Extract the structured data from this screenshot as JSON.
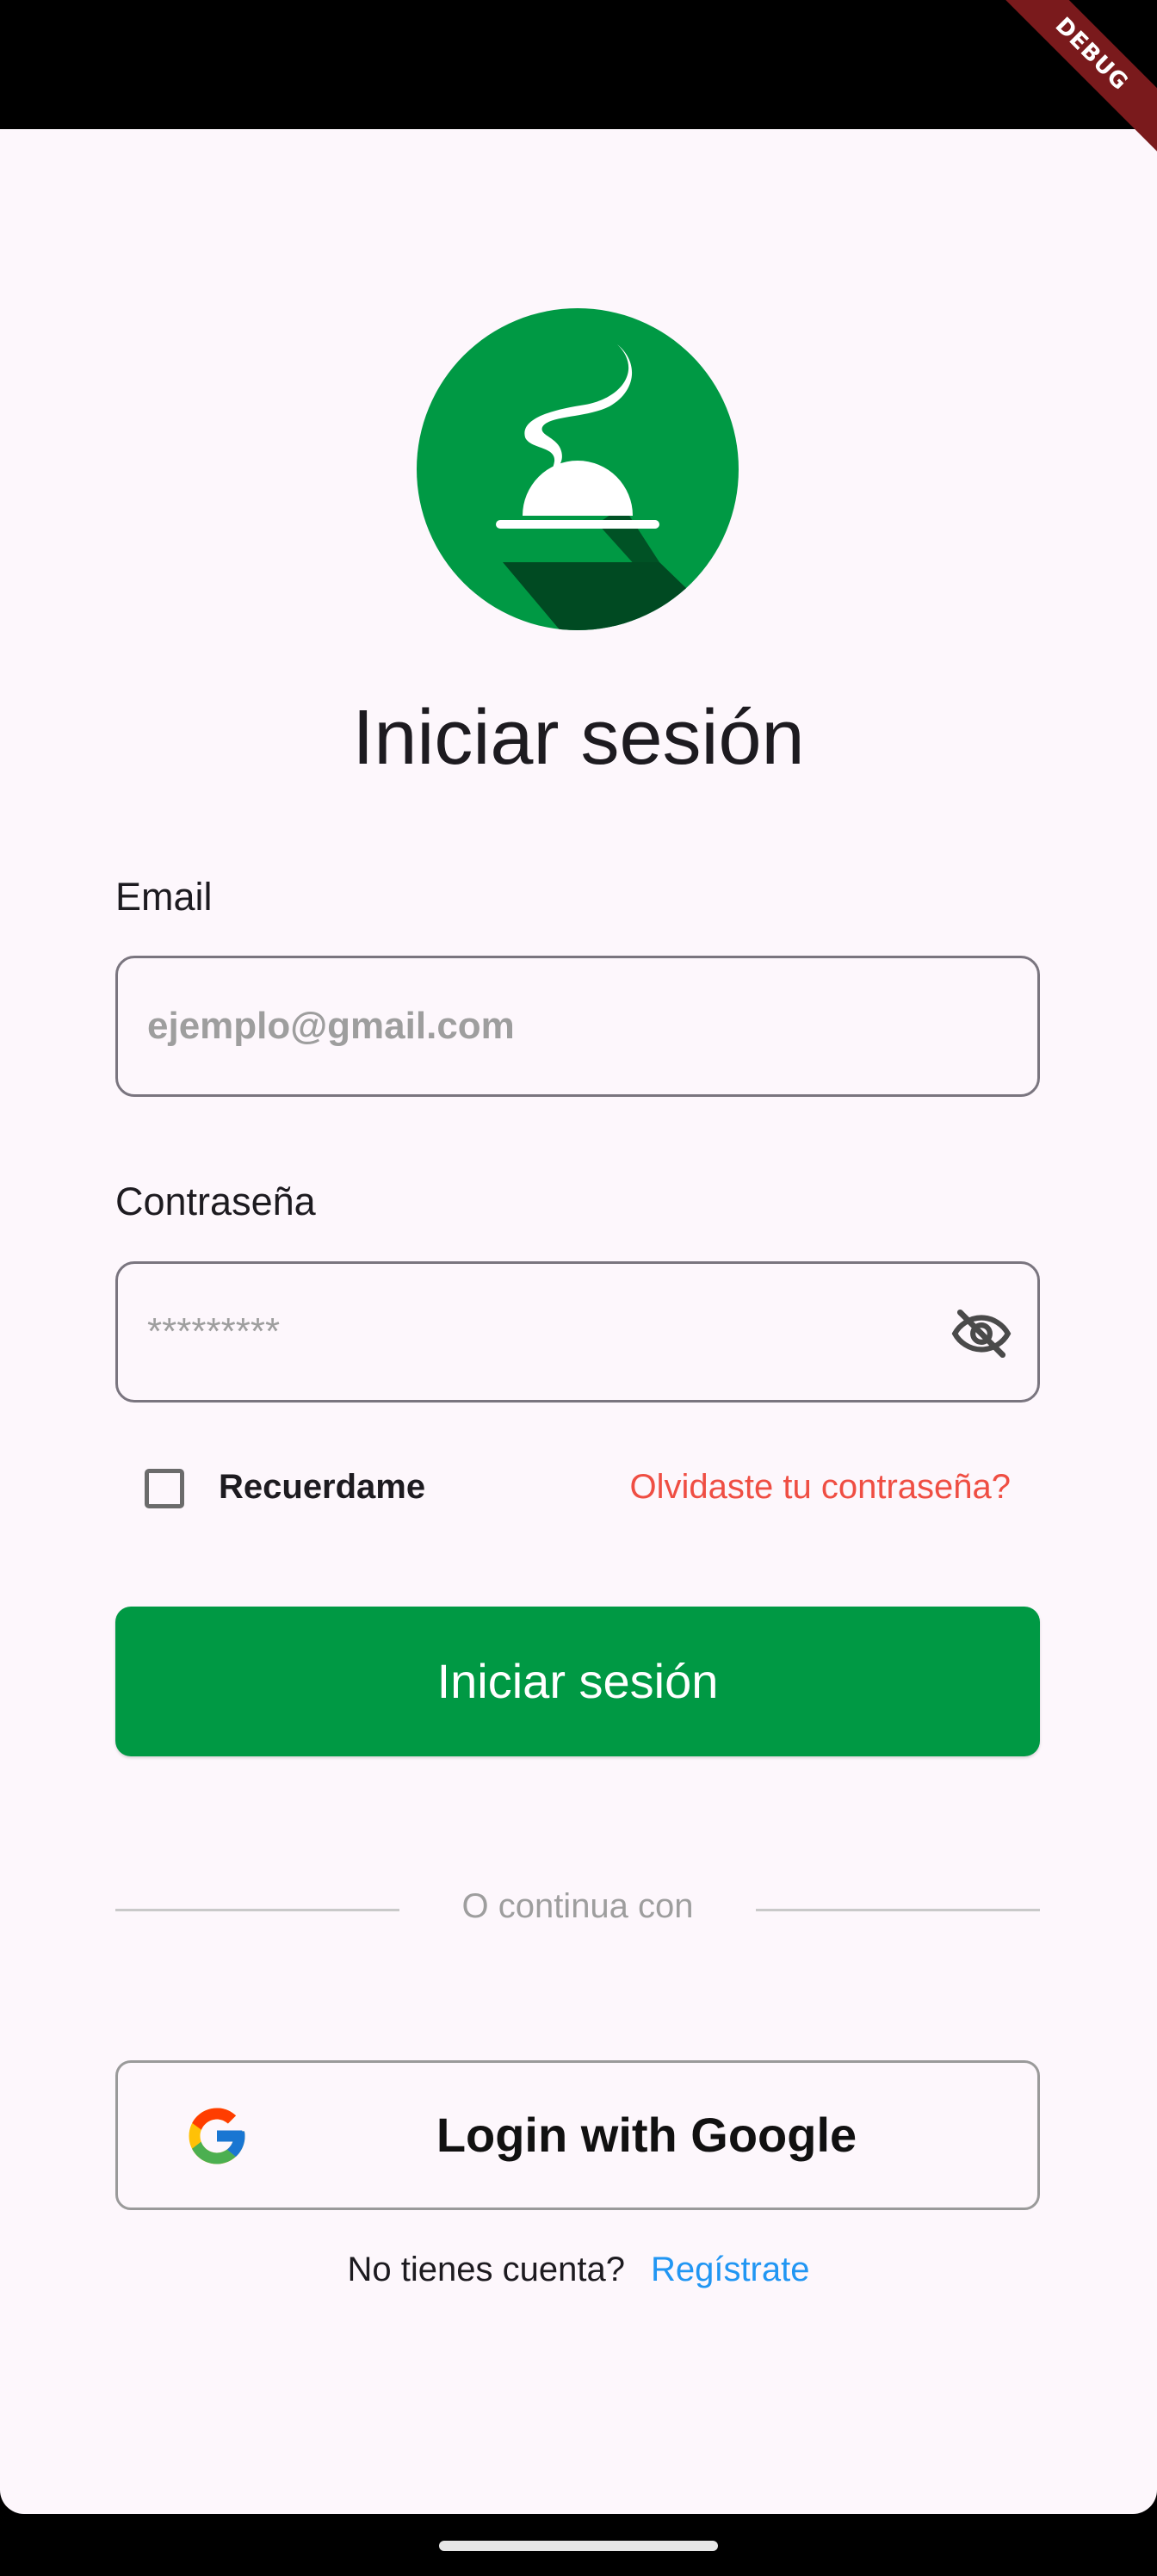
{
  "debug_banner": {
    "label": "DEBUG"
  },
  "logo": {
    "icon": "service-bell-icon",
    "background_color": "#009944"
  },
  "title": "Iniciar sesión",
  "email": {
    "label": "Email",
    "placeholder": "ejemplo@gmail.com",
    "value": ""
  },
  "password": {
    "label": "Contraseña",
    "placeholder": "*********",
    "value": "",
    "toggle_icon": "eye-off-icon"
  },
  "remember": {
    "label": "Recuerdame",
    "checked": false
  },
  "forgot_password": "Olvidaste tu contraseña?",
  "login_button": "Iniciar sesión",
  "divider_text": "O continua con",
  "google_button": {
    "label": "Login with Google",
    "icon": "google-icon"
  },
  "signup": {
    "prompt": "No tienes cuenta?",
    "link": "Regístrate"
  },
  "colors": {
    "primary": "#009944",
    "link_red": "#ef4e43",
    "link_blue": "#2196f3",
    "background": "#fdf7fc"
  }
}
